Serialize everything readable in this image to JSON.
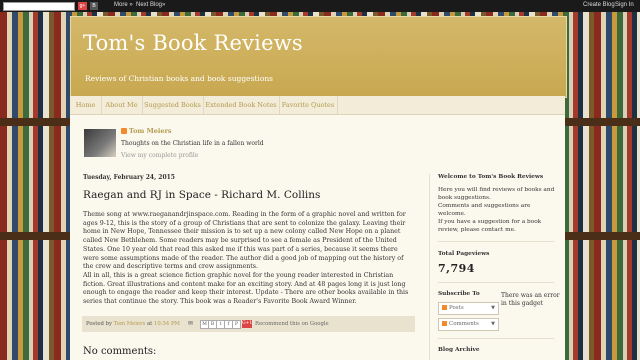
{
  "navbar": {
    "gplus": "g+",
    "blogger": "B",
    "more": "More »",
    "next_blog": "Next Blog»",
    "create_blog": "Create Blog",
    "sign_in": "Sign In"
  },
  "header": {
    "title": "Tom's Book Reviews",
    "description": "Reviews of Christian books and book suggestions"
  },
  "tabs": [
    "Home",
    "About Me",
    "Suggested Books",
    "Extended Book Notes",
    "Favorite Quotes"
  ],
  "profile": {
    "name": "Tom Meiers",
    "about": "Thoughts on the Christian life in a fallen world",
    "link": "View my complete profile"
  },
  "post": {
    "date": "Tuesday, February 24, 2015",
    "title": "Raegan and RJ in Space - Richard M. Collins",
    "body": [
      "Theme song at www.raeganandrjinspace.com.  Reading in the form of a graphic novel and written for ages 9-12, this is the story of a group of Christians that are sent to colonize the galaxy.  Leaving their home in New Hope, Tennessee their mission is to set up a new colony called New Hope on a planet called New Bethlehem. Some readers may be surprised to see a female as President of the United States.  One 10 year old that read this asked me if this was part of a series, because it seems there were some assumptions made of the reader.  The author did a good job of mapping out the history of the crew and descriptive terms and crew assignments.",
      "All in all, this is a great science fiction graphic novel for the young reader interested in Christian fiction. Great illustrations and content make for an exciting story. And at 48 pages long it is just long enough to engage the reader and keep their interest. Update - There are other books available in this series that continue the story.  This book was a Reader's Favorite Book Award Winner."
    ],
    "footer": {
      "posted_by": "Posted by",
      "author": "Tom Meiers",
      "at": "at",
      "time": "10:54 PM",
      "share_buttons": [
        "M",
        "B",
        "t",
        "f",
        "P"
      ],
      "gplus": "G+1",
      "recommend": "Recommend this on Google"
    },
    "comments_title": "No comments:"
  },
  "sidebar": {
    "welcome_title": "Welcome to Tom's Book Reviews",
    "welcome_text": "Here you will find reviews of books and book suggestions.\nComments and suggestions are welcome.\nIf you have a suggestion for a book review, please contact me.",
    "pageviews_title": "Total Pageviews",
    "pageviews": "7,794",
    "subscribe_title": "Subscribe To",
    "subscribe_posts": "Posts",
    "subscribe_comments": "Comments",
    "error_text": "There was an error in this gadget",
    "archive_title": "Blog Archive"
  },
  "colors": {
    "header_gold": "#c8a850",
    "link_gold": "#b49a4e",
    "page_bg": "#fbf8ee",
    "blogger_orange": "#f58a2a"
  }
}
